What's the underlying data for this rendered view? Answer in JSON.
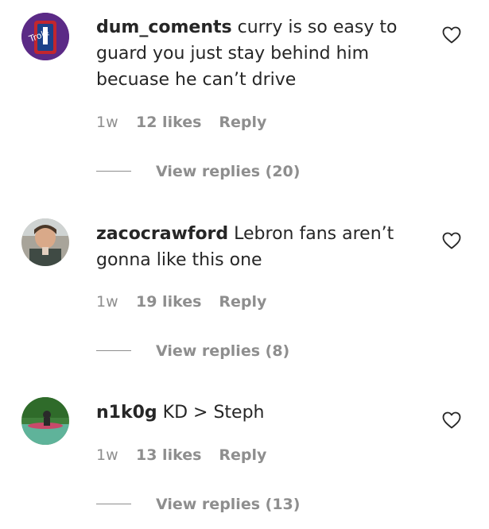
{
  "comments": [
    {
      "username": "dum_coments",
      "text": "curry is so easy to guard you just stay behind him becuase he can’t drive",
      "time": "1w",
      "likes": "12 likes",
      "reply": "Reply",
      "view_replies": "View replies (20)",
      "avatar_icon": "avatar-icon"
    },
    {
      "username": "zacocrawford",
      "text": "Lebron fans aren’t gonna like this one",
      "time": "1w",
      "likes": "19 likes",
      "reply": "Reply",
      "view_replies": "View replies (8)",
      "avatar_icon": "avatar-icon"
    },
    {
      "username": "n1k0g",
      "text": "KD > Steph",
      "time": "1w",
      "likes": "13 likes",
      "reply": "Reply",
      "view_replies": "View replies (13)",
      "avatar_icon": "avatar-icon"
    }
  ],
  "colors": {
    "text": "#262626",
    "muted": "#8e8e8e"
  }
}
